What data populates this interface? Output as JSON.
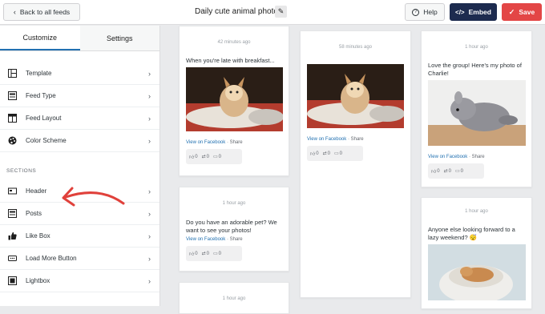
{
  "header": {
    "back_label": "Back to all feeds",
    "title": "Daily cute animal photo",
    "help_label": "Help",
    "embed_label": "Embed",
    "save_label": "Save"
  },
  "sidebar": {
    "tabs": [
      {
        "label": "Customize"
      },
      {
        "label": "Settings"
      }
    ],
    "items": [
      {
        "label": "Template",
        "icon": "template-icon"
      },
      {
        "label": "Feed Type",
        "icon": "feed-type-icon"
      },
      {
        "label": "Feed Layout",
        "icon": "feed-layout-icon"
      },
      {
        "label": "Color Scheme",
        "icon": "palette-icon"
      }
    ],
    "sections_label": "SECTIONS",
    "sections": [
      {
        "label": "Header",
        "icon": "header-icon"
      },
      {
        "label": "Posts",
        "icon": "posts-icon"
      },
      {
        "label": "Like Box",
        "icon": "thumbs-up-icon"
      },
      {
        "label": "Load More Button",
        "icon": "load-more-icon"
      },
      {
        "label": "Lightbox",
        "icon": "lightbox-icon"
      }
    ]
  },
  "posts": [
    {
      "time": "42 minutes ago",
      "caption": "When you're late with breakfast...",
      "link": "View on Facebook",
      "share": "Share",
      "likes": "0",
      "shares": "0",
      "comments": "0"
    },
    {
      "time": "1 hour ago",
      "caption": "Do you have an adorable pet? We want to see your photos!",
      "link": "View on Facebook",
      "share": "Share",
      "likes": "0",
      "shares": "0",
      "comments": "0"
    },
    {
      "time": "1 hour ago"
    },
    {
      "time": "58 minutes ago",
      "link": "View on Facebook",
      "share": "Share",
      "likes": "0",
      "shares": "0",
      "comments": "0"
    },
    {
      "time": "1 hour ago",
      "caption": "Love the group! Here's my photo of Charlie!",
      "link": "View on Facebook",
      "share": "Share",
      "likes": "0",
      "shares": "0",
      "comments": "0"
    },
    {
      "time": "1 hour ago",
      "caption": "Anyone else looking forward to a lazy weekend? 😴"
    }
  ],
  "dot": "·",
  "colors": {
    "embed": "#1d2b4f",
    "save": "#e34646",
    "link": "#2271b1",
    "arrow": "#e0413b"
  }
}
